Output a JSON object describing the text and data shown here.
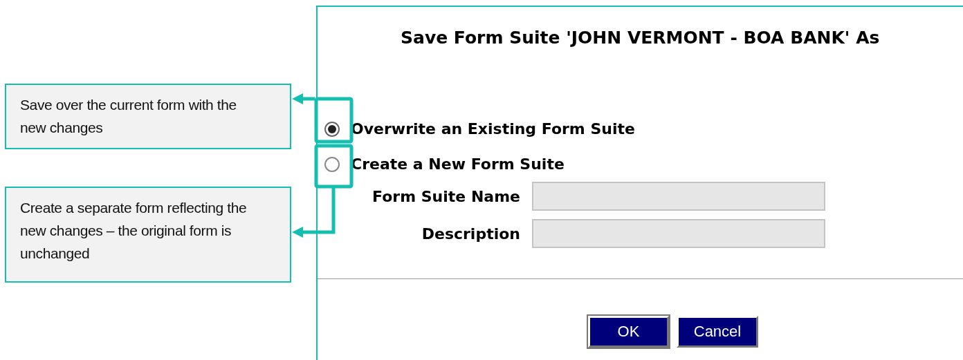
{
  "callouts": [
    {
      "text": "Save over the current form with the new changes"
    },
    {
      "text": "Create a separate form reflecting the new changes – the original form is unchanged"
    }
  ],
  "dialog": {
    "title": "Save Form Suite 'JOHN VERMONT - BOA BANK' As",
    "options": [
      {
        "label": "Overwrite an Existing Form Suite",
        "selected": true
      },
      {
        "label": "Create a New Form Suite",
        "selected": false
      }
    ],
    "fields": [
      {
        "label": "Form Suite Name"
      },
      {
        "label": "Description"
      }
    ],
    "buttons": [
      {
        "label": "OK",
        "default": true
      },
      {
        "label": "Cancel",
        "default": false
      }
    ]
  }
}
